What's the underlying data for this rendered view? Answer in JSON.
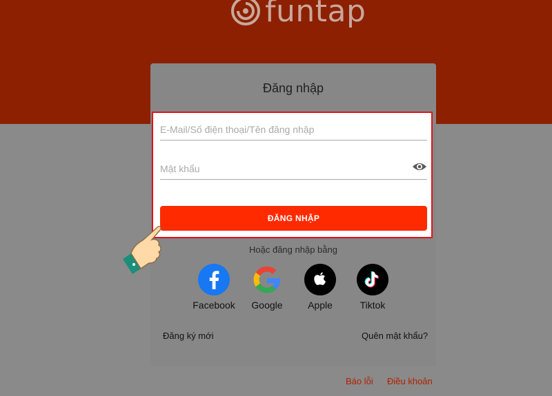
{
  "brand": {
    "name": "funtap"
  },
  "login": {
    "title": "Đăng nhập",
    "username_placeholder": "E-Mail/Số điện thoại/Tên đăng nhập",
    "password_placeholder": "Mật khẩu",
    "submit_label": "ĐĂNG NHẬP",
    "alt_login_text": "Hoặc đăng nhập bằng"
  },
  "social": [
    {
      "label": "Facebook",
      "icon": "facebook-icon",
      "color": "#1877f2"
    },
    {
      "label": "Google",
      "icon": "google-icon",
      "color": "#ffffff"
    },
    {
      "label": "Apple",
      "icon": "apple-icon",
      "color": "#000000"
    },
    {
      "label": "Tiktok",
      "icon": "tiktok-icon",
      "color": "#000000"
    }
  ],
  "links": {
    "register": "Đăng ký mới",
    "forgot_password": "Quên mật khẩu?"
  },
  "footer": {
    "report": "Báo lỗi",
    "terms": "Điều khoản"
  },
  "colors": {
    "header_band": "#8c2000",
    "accent": "#ff2a00",
    "highlight_border": "#e0121b"
  }
}
